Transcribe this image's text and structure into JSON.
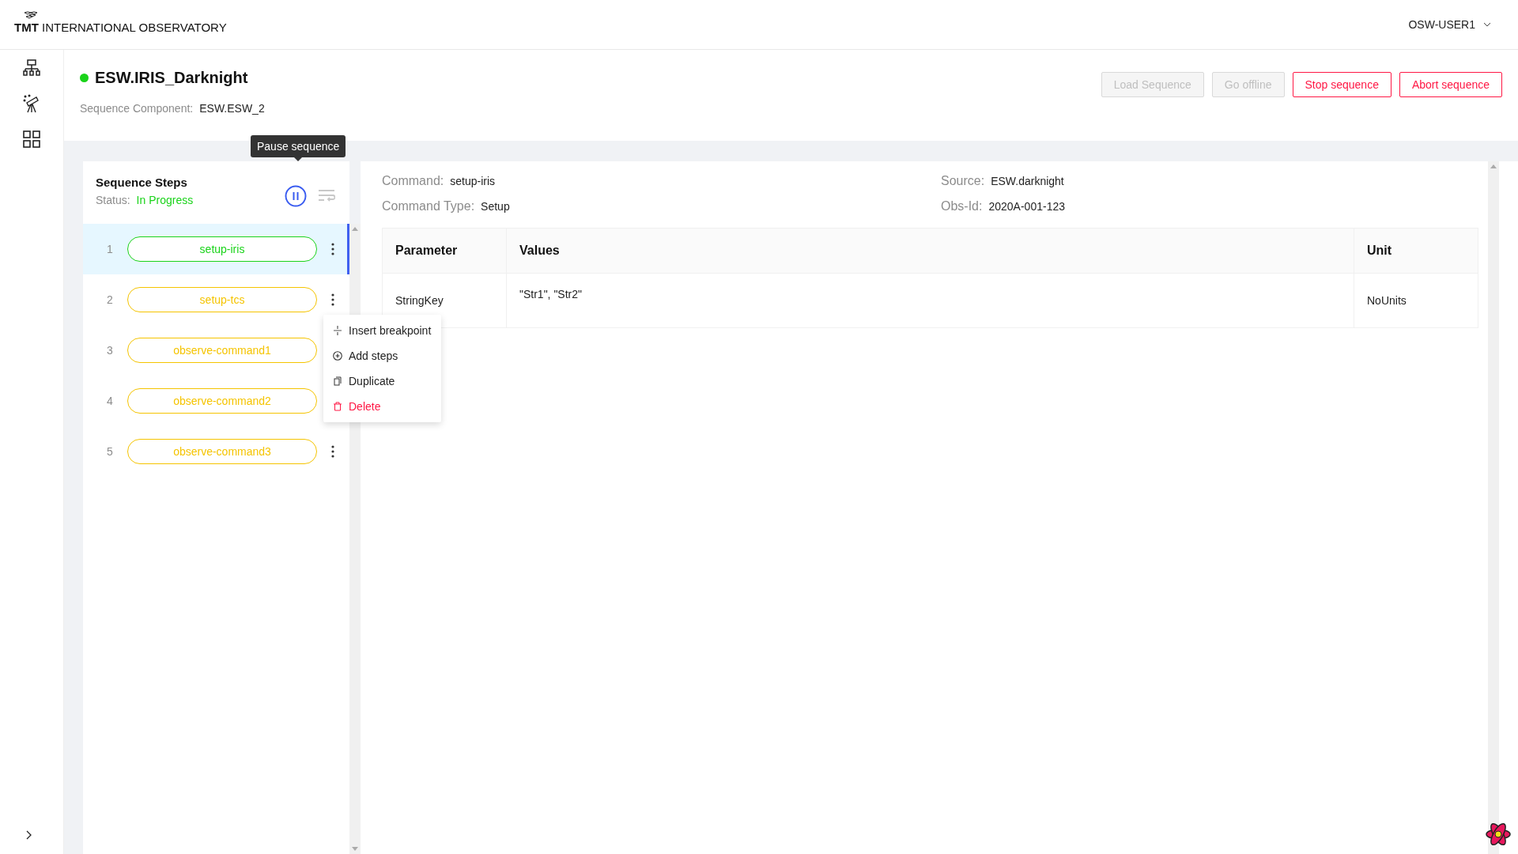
{
  "header": {
    "logo": "**TMT** INTERNATIONAL OBSERVATORY",
    "user": "OSW-USER1"
  },
  "sequencer": {
    "name": "ESW.IRIS_Darknight",
    "online": true,
    "component_label": "Sequence Component:",
    "component_value": "ESW.ESW_2"
  },
  "actions": [
    {
      "label": "Load Sequence",
      "disabled": true,
      "kind": "default"
    },
    {
      "label": "Go offline",
      "disabled": true,
      "kind": "default"
    },
    {
      "label": "Stop sequence",
      "disabled": false,
      "kind": "danger"
    },
    {
      "label": "Abort sequence",
      "disabled": false,
      "kind": "danger"
    }
  ],
  "steps_panel": {
    "title": "Sequence Steps",
    "status_label": "Status:",
    "status_value": "In Progress",
    "tooltip": "Pause sequence",
    "steps": [
      {
        "number": "1",
        "name": "setup-iris",
        "color": "#1ad31a",
        "selected": true,
        "menu_button": true
      },
      {
        "number": "2",
        "name": "setup-tcs",
        "color": "#f5c400",
        "selected": false,
        "menu_button": true
      },
      {
        "number": "3",
        "name": "observe-command1",
        "color": "#f5c400",
        "selected": false,
        "menu_button": false
      },
      {
        "number": "4",
        "name": "observe-command2",
        "color": "#f5c400",
        "selected": false,
        "menu_button": false
      },
      {
        "number": "5",
        "name": "observe-command3",
        "color": "#f5c400",
        "selected": false,
        "menu_button": true
      }
    ],
    "menu": [
      {
        "label": "Insert breakpoint",
        "kind": "breakpoint"
      },
      {
        "label": "Add steps",
        "kind": "add"
      },
      {
        "label": "Duplicate",
        "kind": "duplicate"
      },
      {
        "label": "Delete",
        "kind": "delete"
      }
    ]
  },
  "details": {
    "fields": [
      {
        "label": "Command:",
        "value": "setup-iris"
      },
      {
        "label": "Source:",
        "value": "ESW.darknight"
      },
      {
        "label": "Command Type:",
        "value": "Setup"
      },
      {
        "label": "Obs-Id:",
        "value": "2020A-001-123"
      }
    ],
    "table": {
      "columns": [
        "Parameter",
        "Values",
        "Unit"
      ],
      "rows": [
        [
          "StringKey",
          "\"Str1\", \"Str2\"",
          "NoUnits"
        ]
      ]
    }
  }
}
